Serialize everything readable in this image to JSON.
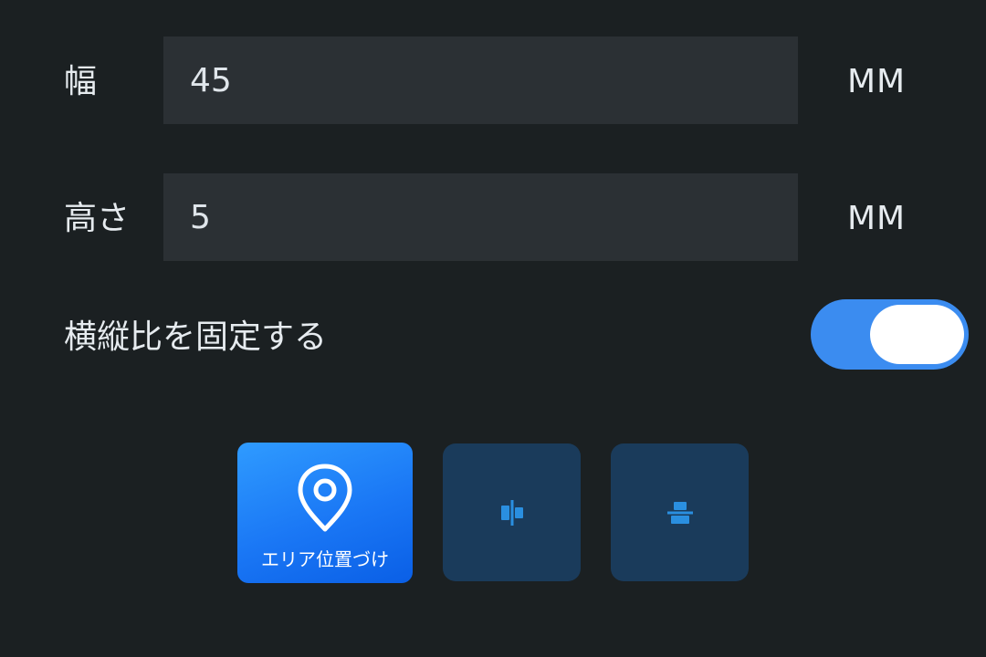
{
  "size_panel": {
    "width": {
      "label": "幅",
      "value": "45",
      "unit": "MM"
    },
    "height": {
      "label": "高さ",
      "value": "5",
      "unit": "MM"
    },
    "aspect_lock": {
      "label": "横縦比を固定する",
      "enabled": true
    }
  },
  "toolbar": {
    "area_position": {
      "label": "エリア位置づけ",
      "icon": "location-pin-icon"
    },
    "align_horizontal_center": {
      "icon": "align-horizontal-center-icon"
    },
    "align_vertical_center": {
      "icon": "align-vertical-center-icon"
    }
  },
  "colors": {
    "background": "#1b2022",
    "input_background": "#2b3034",
    "accent": "#3b8cf0",
    "secondary_button": "#1a3b5b",
    "icon_accent": "#2a8fe0"
  }
}
